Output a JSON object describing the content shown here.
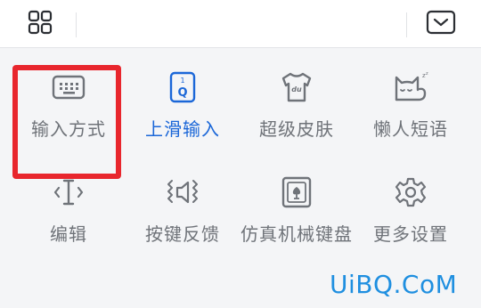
{
  "toolbar": {
    "left_icon": "grid-icon",
    "right_icon": "collapse-keyboard-icon"
  },
  "menu": {
    "items": [
      {
        "label": "输入方式",
        "icon": "keyboard-icon"
      },
      {
        "label": "上滑输入",
        "icon": "swipe-up-input-icon"
      },
      {
        "label": "超级皮肤",
        "icon": "skin-shirt-icon"
      },
      {
        "label": "懒人短语",
        "icon": "lazy-cat-icon"
      },
      {
        "label": "编辑",
        "icon": "text-cursor-icon"
      },
      {
        "label": "按键反馈",
        "icon": "speaker-vibration-icon"
      },
      {
        "label": "仿真机械键盘",
        "icon": "mechanical-key-icon"
      },
      {
        "label": "更多设置",
        "icon": "gear-icon"
      }
    ],
    "active_index": 1,
    "highlighted_index": 0
  },
  "colors": {
    "accent": "#1b67d8",
    "icon_gray": "#6f7379",
    "highlight": "#e8262d",
    "watermark": "#1f8fe0"
  },
  "watermark": "UiBQ.CoM"
}
